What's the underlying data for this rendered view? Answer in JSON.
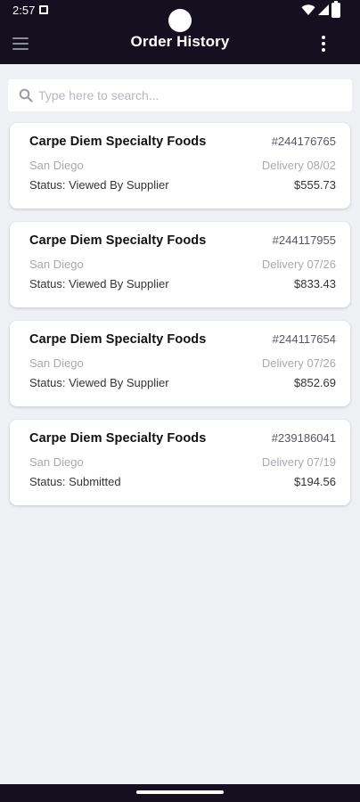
{
  "status_bar": {
    "time": "2:57"
  },
  "header": {
    "title": "Order History"
  },
  "search": {
    "placeholder": "Type here to search..."
  },
  "orders": [
    {
      "supplier": "Carpe Diem Specialty Foods",
      "order_number": "#244176765",
      "city": "San Diego",
      "delivery": "Delivery 08/02",
      "status": "Status: Viewed By Supplier",
      "amount": "$555.73"
    },
    {
      "supplier": "Carpe Diem Specialty Foods",
      "order_number": "#244117955",
      "city": "San Diego",
      "delivery": "Delivery 07/26",
      "status": "Status: Viewed By Supplier",
      "amount": "$833.43"
    },
    {
      "supplier": "Carpe Diem Specialty Foods",
      "order_number": "#244117654",
      "city": "San Diego",
      "delivery": "Delivery 07/26",
      "status": "Status: Viewed By Supplier",
      "amount": "$852.69"
    },
    {
      "supplier": "Carpe Diem Specialty Foods",
      "order_number": "#239186041",
      "city": "San Diego",
      "delivery": "Delivery 07/19",
      "status": "Status: Submitted",
      "amount": "$194.56"
    }
  ],
  "colors": {
    "header_bg": "#14101f",
    "page_bg": "#eef0f3",
    "card_bg": "#ffffff",
    "muted_text": "#a8aab2"
  },
  "icons": {
    "menu": "hamburger-icon",
    "more": "more-vertical-icon",
    "search": "search-icon",
    "wifi": "wifi-icon",
    "signal": "signal-icon",
    "battery": "battery-icon",
    "notification": "notification-icon"
  }
}
